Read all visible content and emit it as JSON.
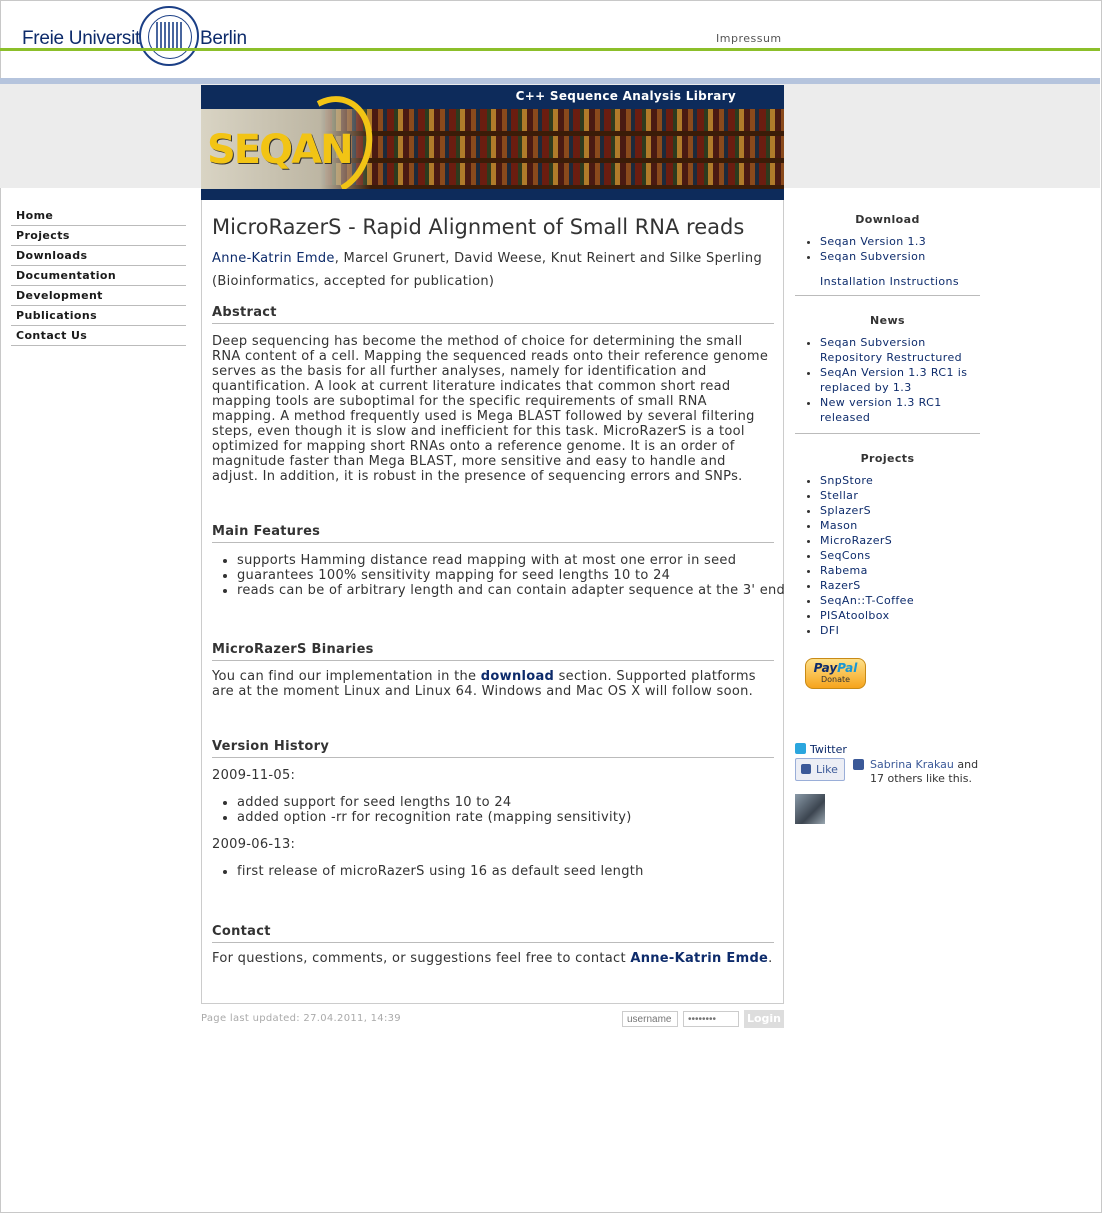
{
  "header": {
    "logo_left": "Freie Universität",
    "logo_right": "Berlin",
    "impressum": "Impressum"
  },
  "banner": {
    "tagline": "C++ Sequence Analysis Library",
    "logo_text": "SEQAN"
  },
  "nav": {
    "items": [
      "Home",
      "Projects",
      "Downloads",
      "Documentation",
      "Development",
      "Publications",
      "Contact Us"
    ]
  },
  "main": {
    "title": "MicroRazerS - Rapid Alignment of Small RNA reads",
    "first_author": "Anne-Katrin Emde",
    "other_authors": ", Marcel Grunert, David Weese, Knut Reinert and Silke Sperling",
    "venue": "(Bioinformatics, accepted for publication)",
    "abstract_heading": "Abstract",
    "abstract_text": "Deep sequencing has become the method of choice for determining the small RNA content of a cell. Mapping the sequenced reads onto their reference genome serves as the basis for all further analyses, namely for identification and quantification. A look at current literature indicates that common short read mapping tools are suboptimal for the specific requirements of small RNA mapping. A method frequently used is Mega BLAST followed by several filtering steps, even though it is slow and inefficient for this task. MicroRazerS is a tool optimized for mapping short RNAs onto a reference genome. It is an order of magnitude faster than Mega BLAST, more sensitive and easy to handle and adjust. In addition, it is robust in the presence of sequencing errors and SNPs.",
    "features_heading": "Main Features",
    "features": [
      "supports Hamming distance read mapping with at most one error in seed",
      "guarantees 100% sensitivity mapping for seed lengths 10 to 24",
      "reads can be of arbitrary length and can contain adapter sequence at the 3' end"
    ],
    "binaries_heading": "MicroRazerS Binaries",
    "binaries_pre": "You can find our implementation in the ",
    "binaries_link": "download",
    "binaries_post": " section. Supported platforms are at the moment Linux and Linux 64. Windows and Mac OS X will follow soon.",
    "history_heading": "Version History",
    "history": [
      {
        "date": "2009-11-05:",
        "items": [
          "added support for seed lengths 10 to 24",
          "added option -rr for recognition rate (mapping sensitivity)"
        ]
      },
      {
        "date": "2009-06-13:",
        "items": [
          "first release of microRazerS using 16 as default seed length"
        ]
      }
    ],
    "contact_heading": "Contact",
    "contact_pre": "For questions, comments, or suggestions feel free to contact ",
    "contact_link": "Anne-Katrin Emde",
    "contact_post": "."
  },
  "footer": {
    "updated": "Page last updated: 27.04.2011, 14:39",
    "username_placeholder": "username",
    "password_placeholder": "••••••••",
    "login_label": "Login"
  },
  "sidebar": {
    "download_heading": "Download",
    "download_items": [
      "Seqan Version 1.3",
      "Seqan Subversion"
    ],
    "install_link": "Installation Instructions",
    "news_heading": "News",
    "news_items": [
      "Seqan Subversion Repository Restructured",
      "SeqAn Version 1.3 RC1 is replaced by 1.3",
      "New version 1.3 RC1 released"
    ],
    "projects_heading": "Projects",
    "project_items": [
      "SnpStore",
      "Stellar",
      "SplazerS",
      "Mason",
      "MicroRazerS",
      "SeqCons",
      "Rabema",
      "RazerS",
      "SeqAn::T-Coffee",
      "PISAtoolbox",
      "DFI"
    ],
    "paypal_pay": "Pay",
    "paypal_pal": "Pal",
    "paypal_donate": "Donate",
    "twitter": "Twitter",
    "like_label": "Like",
    "fb_name": "Sabrina Krakau",
    "fb_rest": " and 17 others like this."
  }
}
